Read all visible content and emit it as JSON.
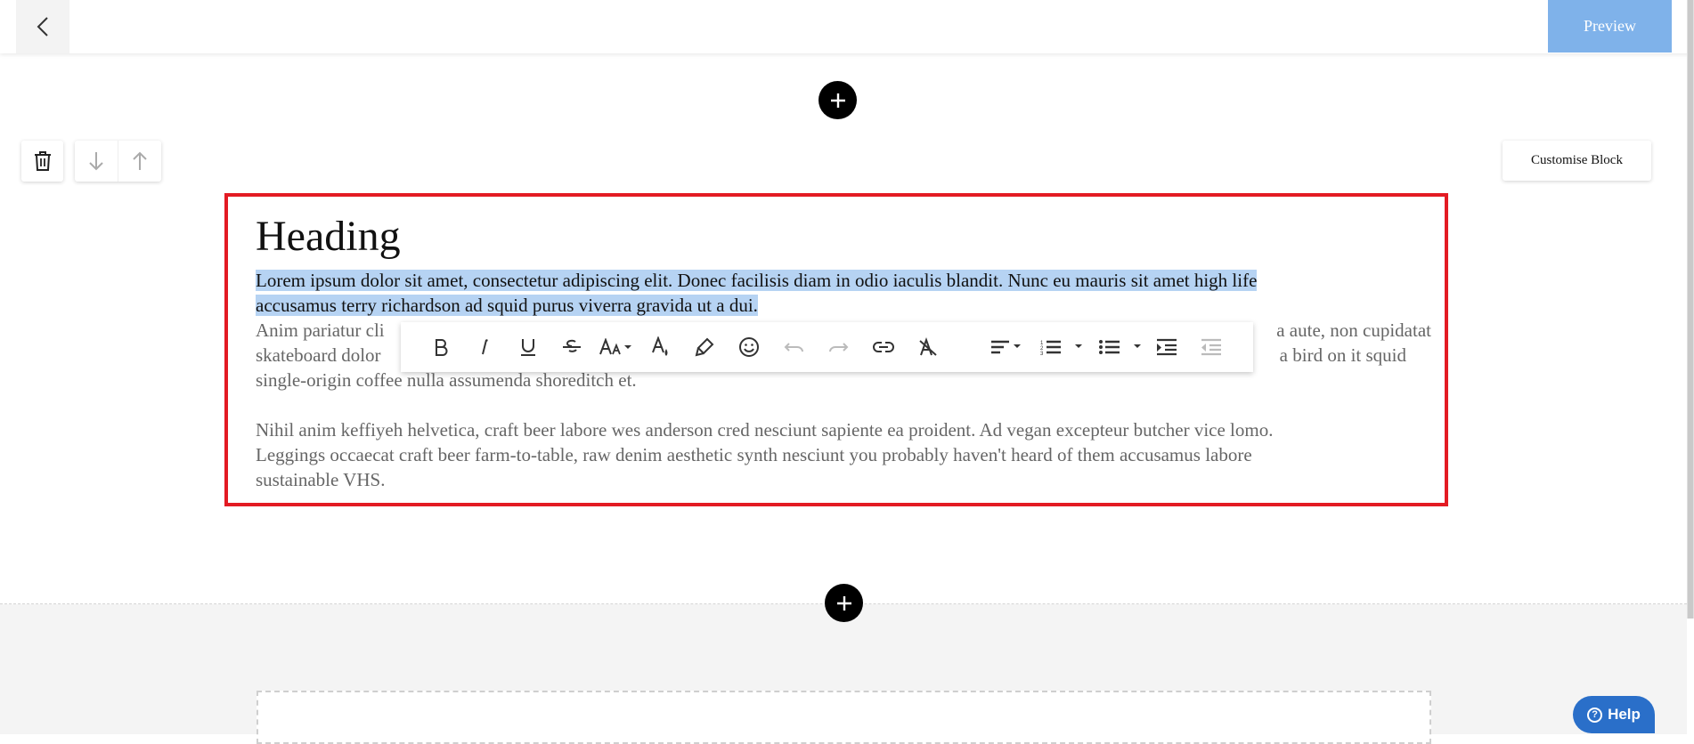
{
  "topbar": {
    "back_icon": "chevron-left-icon",
    "preview_label": "Preview"
  },
  "block_controls": {
    "delete_icon": "trash-icon",
    "move_down_icon": "arrow-down-icon",
    "move_up_icon": "arrow-up-icon",
    "customise_label": "Customise Block"
  },
  "add_icon": "plus-icon",
  "content": {
    "heading": "Heading",
    "selected_text_line1": "Lorem ipsum dolor sit amet, consectetur adipiscing elit. Donec facilisis diam in odio iaculis blandit. Nunc eu mauris sit amet high life",
    "selected_text_line2": "accusamus terry richardson ad squid purus viverra gravida ut a dui.",
    "para2_line1_left": "Anim pariatur cli",
    "para2_line1_right": "a aute, non cupidatat",
    "para2_line2_left": "skateboard dolor",
    "para2_line2_right": "a bird on it squid",
    "para2_line3": "single-origin coffee nulla assumenda shoreditch et.",
    "para3_line1": "Nihil anim keffiyeh helvetica, craft beer labore wes anderson cred nesciunt sapiente ea proident. Ad vegan excepteur butcher vice lomo.",
    "para3_line2": "Leggings occaecat craft beer farm-to-table, raw denim aesthetic synth nesciunt you probably haven't heard of them accusamus labore",
    "para3_line3": "sustainable VHS."
  },
  "toolbar": {
    "items": [
      "bold-icon",
      "italic-icon",
      "underline-icon",
      "strikethrough-icon",
      "font-size-icon",
      "text-color-icon",
      "highlight-icon",
      "emoji-icon",
      "undo-icon",
      "redo-icon",
      "link-icon",
      "clear-format-icon",
      "align-icon",
      "ordered-list-icon",
      "unordered-list-icon",
      "indent-icon",
      "outdent-icon"
    ]
  },
  "help": {
    "label": "Help",
    "icon_glyph": "?"
  },
  "colors": {
    "accent_preview": "#7fb2ea",
    "block_border": "#e31b23",
    "selection": "#b6d3f3",
    "help_bg": "#2a6fc9"
  }
}
